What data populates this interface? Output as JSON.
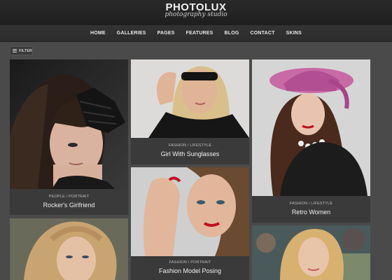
{
  "site": {
    "title": "PHOTOLUX",
    "subtitle": "photography studio"
  },
  "nav": {
    "items": [
      "HOME",
      "GALLERIES",
      "PAGES",
      "FEATURES",
      "BLOG",
      "CONTACT",
      "SKINS"
    ]
  },
  "filter": {
    "icon": "menu-lines-icon",
    "label": "FILTER"
  },
  "gallery": {
    "cards": [
      {
        "category": "PEOPLE / PORTRAIT",
        "title": "Rocker's Girlfriend"
      },
      {
        "category": "FASHION / LIFESTYLE",
        "title": "Girl With Sunglasses"
      },
      {
        "category": "FASHION / LIFESTYLE",
        "title": "Retro Women"
      },
      {
        "category": "FASHION / PORTRAIT",
        "title": "Fashion Model Posing"
      },
      {
        "category": "",
        "title": ""
      },
      {
        "category": "",
        "title": ""
      }
    ]
  },
  "colors": {
    "page_bg": "#4a4a4a",
    "header_bg": "#1e1e1e",
    "caption_bg": "#3a3a3a",
    "hat_pink": "#c060a0",
    "lips_red": "#c01020"
  }
}
